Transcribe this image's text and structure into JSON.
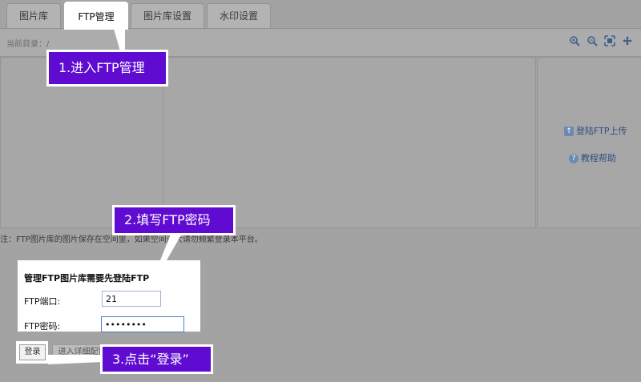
{
  "tabs": [
    {
      "label": "图片库"
    },
    {
      "label": "FTP管理"
    },
    {
      "label": "图片库设置"
    },
    {
      "label": "水印设置"
    }
  ],
  "path": {
    "label": "当前目录：/"
  },
  "toolbar": {
    "icons": [
      "zoom-in-icon",
      "zoom-out-icon",
      "fit-icon",
      "move-icon"
    ]
  },
  "side": {
    "login_link": "登陆FTP上传",
    "help_link": "教程帮助"
  },
  "note": "注：FTP图片库的图片保存在空间里，如果空间过大请勿频繁登录本平台。",
  "form": {
    "title": "管理FTP图片库需要先登陆FTP",
    "port_label": "FTP端口:",
    "port_value": "21",
    "password_label": "FTP密码:",
    "password_value": "••••••••"
  },
  "buttons": {
    "login": "登录",
    "detail": "进入详细配置"
  },
  "callouts": {
    "step1": "1.进入FTP管理",
    "step2": "2.填写FTP密码",
    "step3": "3.点击“登录”"
  },
  "colors": {
    "callout": "#5f0bd1",
    "overlay": "#a3a3a3"
  }
}
